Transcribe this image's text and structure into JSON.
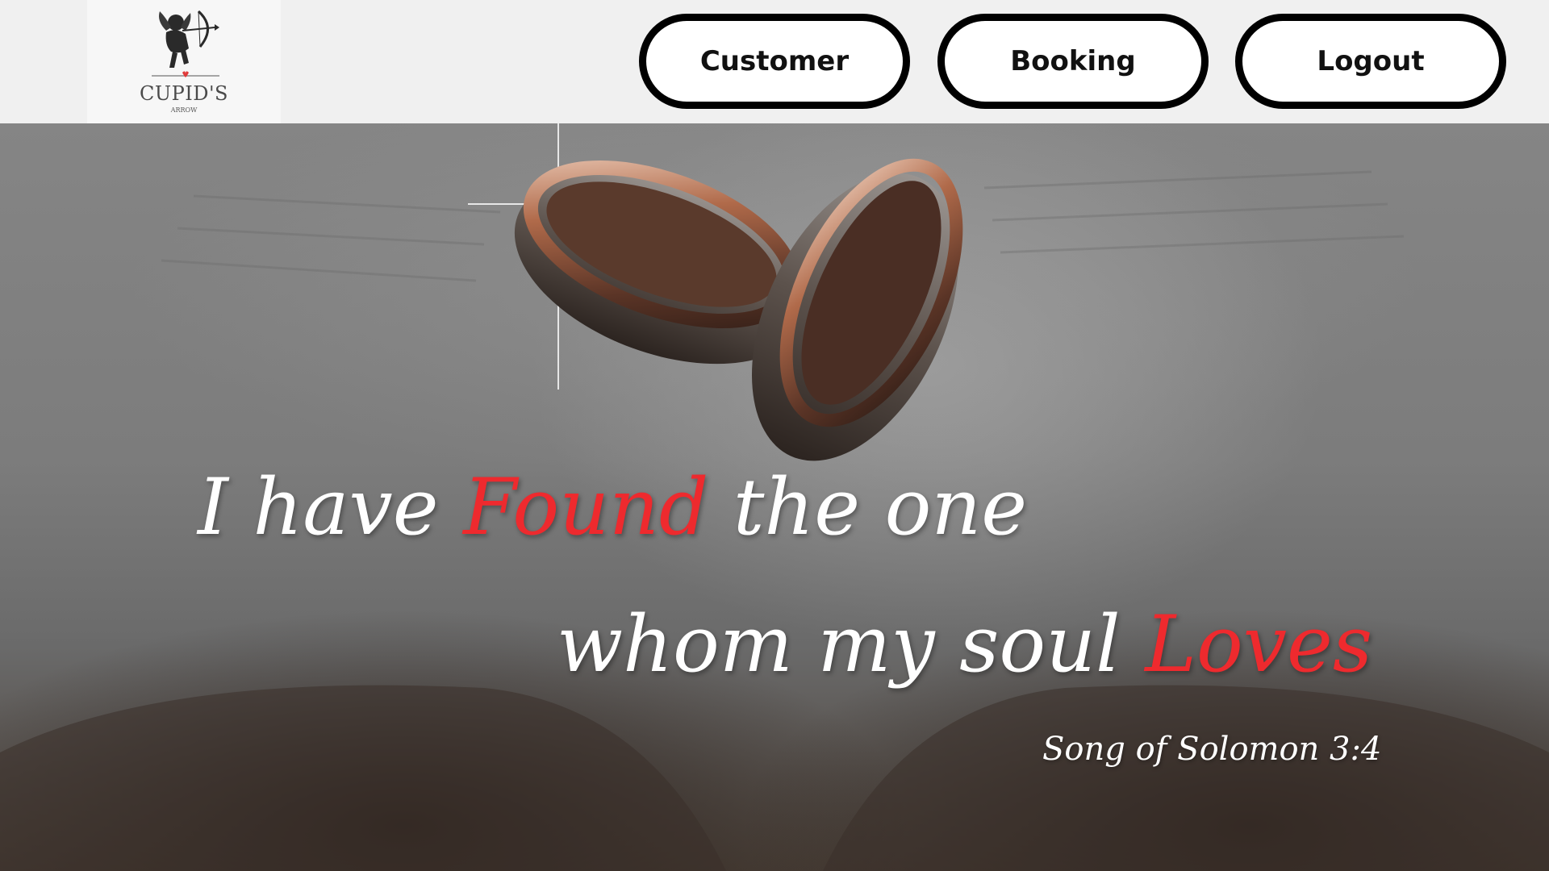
{
  "header": {
    "logo": {
      "name": "CUPID'S",
      "tagline": "ARROW"
    },
    "nav": {
      "customer_label": "Customer",
      "booking_label": "Booking",
      "logout_label": "Logout"
    }
  },
  "hero": {
    "line1": {
      "before": "I have ",
      "accent": "Found",
      "after": " the one"
    },
    "line2": {
      "before": "whom my soul ",
      "accent": "Loves"
    },
    "citation": "Song of Solomon 3:4"
  },
  "colors": {
    "accent_red": "#ee2a2e",
    "header_bg": "#f0f0f0",
    "button_border": "#000000",
    "quote_text": "#ffffff"
  },
  "icons": {
    "logo_mark": "cupid-icon"
  }
}
